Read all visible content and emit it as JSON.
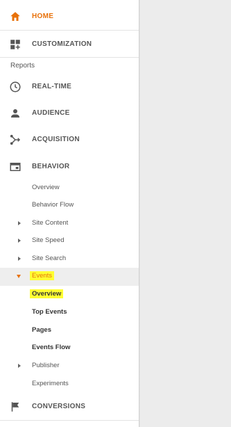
{
  "nav": {
    "home": {
      "label": "HOME",
      "icon": "home-icon"
    },
    "customization": {
      "label": "CUSTOMIZATION",
      "icon": "dashboard-plus-icon"
    },
    "reports_heading": "Reports",
    "realtime": {
      "label": "REAL-TIME",
      "icon": "clock-icon"
    },
    "audience": {
      "label": "AUDIENCE",
      "icon": "person-icon"
    },
    "acquisition": {
      "label": "ACQUISITION",
      "icon": "acquisition-arrows-icon"
    },
    "behavior": {
      "label": "BEHAVIOR",
      "icon": "browser-window-icon",
      "items": [
        {
          "label": "Overview"
        },
        {
          "label": "Behavior Flow"
        },
        {
          "label": "Site Content"
        },
        {
          "label": "Site Speed"
        },
        {
          "label": "Site Search"
        },
        {
          "label": "Events"
        },
        {
          "label": "Overview"
        },
        {
          "label": "Top Events"
        },
        {
          "label": "Pages"
        },
        {
          "label": "Events Flow"
        },
        {
          "label": "Publisher"
        },
        {
          "label": "Experiments"
        }
      ]
    },
    "conversions": {
      "label": "CONVERSIONS",
      "icon": "flag-icon"
    }
  },
  "colors": {
    "accent": "#e8710a",
    "highlight": "#ffff33",
    "text": "#555555",
    "background": "#ececec"
  }
}
